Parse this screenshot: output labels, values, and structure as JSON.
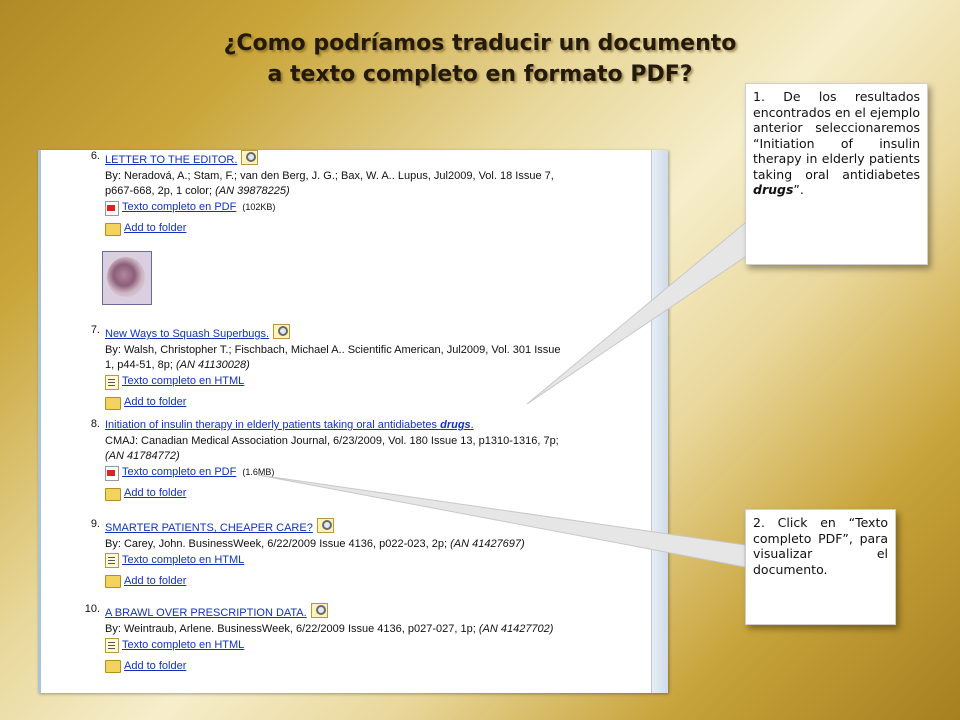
{
  "title": {
    "line1": "¿Como podríamos traducir un documento",
    "line2": "a texto completo en formato PDF?"
  },
  "results": [
    {
      "num": "6.",
      "title": "LETTER TO THE EDITOR.",
      "meta1": "By: Neradová, A.; Stam, F.; van den Berg, J. G.; Bax, W. A.. Lupus, Jul2009, Vol. 18 Issue 7,",
      "meta2": "p667-668, 2p, 1 color; ",
      "an": "(AN 39878225)",
      "fulltext": "Texto completo en PDF",
      "fulltext_type": "pdf",
      "size": "(102KB)",
      "folder": "Add to folder"
    },
    {
      "num": "7.",
      "title": "New Ways to Squash Superbugs.",
      "meta1": "By: Walsh, Christopher T.; Fischbach, Michael A.. Scientific American, Jul2009, Vol. 301 Issue",
      "meta2": "1, p44-51, 8p; ",
      "an": "(AN 41130028)",
      "fulltext": "Texto completo en HTML",
      "fulltext_type": "html",
      "folder": "Add to folder"
    },
    {
      "num": "8.",
      "title": "Initiation of insulin therapy in elderly patients taking oral antidiabetes ",
      "title_em": "drugs",
      "meta1": "CMAJ: Canadian Medical Association Journal, 6/23/2009, Vol. 180 Issue 13, p1310-1316, 7p;",
      "meta2": "",
      "an": "(AN 41784772)",
      "fulltext": "Texto completo en PDF",
      "fulltext_type": "pdf",
      "size": "(1.6MB)",
      "folder": "Add to folder"
    },
    {
      "num": "9.",
      "title": "SMARTER PATIENTS, CHEAPER CARE?",
      "meta1": "By: Carey, John. BusinessWeek, 6/22/2009 Issue 4136, p022-023, 2p; ",
      "meta2": "",
      "an": "(AN 41427697)",
      "fulltext": "Texto completo en HTML",
      "fulltext_type": "html",
      "folder": "Add to folder"
    },
    {
      "num": "10.",
      "title": "A BRAWL OVER PRESCRIPTION DATA.",
      "meta1": "By: Weintraub, Arlene. BusinessWeek, 6/22/2009 Issue 4136, p027-027, 1p; ",
      "meta2": "",
      "an": "(AN 41427702)",
      "fulltext": "Texto completo en HTML",
      "fulltext_type": "html",
      "folder": "Add to folder"
    }
  ],
  "callouts": {
    "first": {
      "text": "1. De los resultados encontrados en el ejemplo anterior seleccionaremos “Initiation of insulin therapy in elderly patients taking oral antidiabetes ",
      "emph": "drugs",
      "tail": "”."
    },
    "second": {
      "text": "2. Click en “Texto completo PDF”, para visualizar el documento."
    }
  },
  "icons": {
    "magnifier": "magnifier-icon",
    "pdf": "pdf-icon",
    "html": "html-document-icon",
    "folder": "folder-icon",
    "thumbnail": "image-thumbnail"
  }
}
